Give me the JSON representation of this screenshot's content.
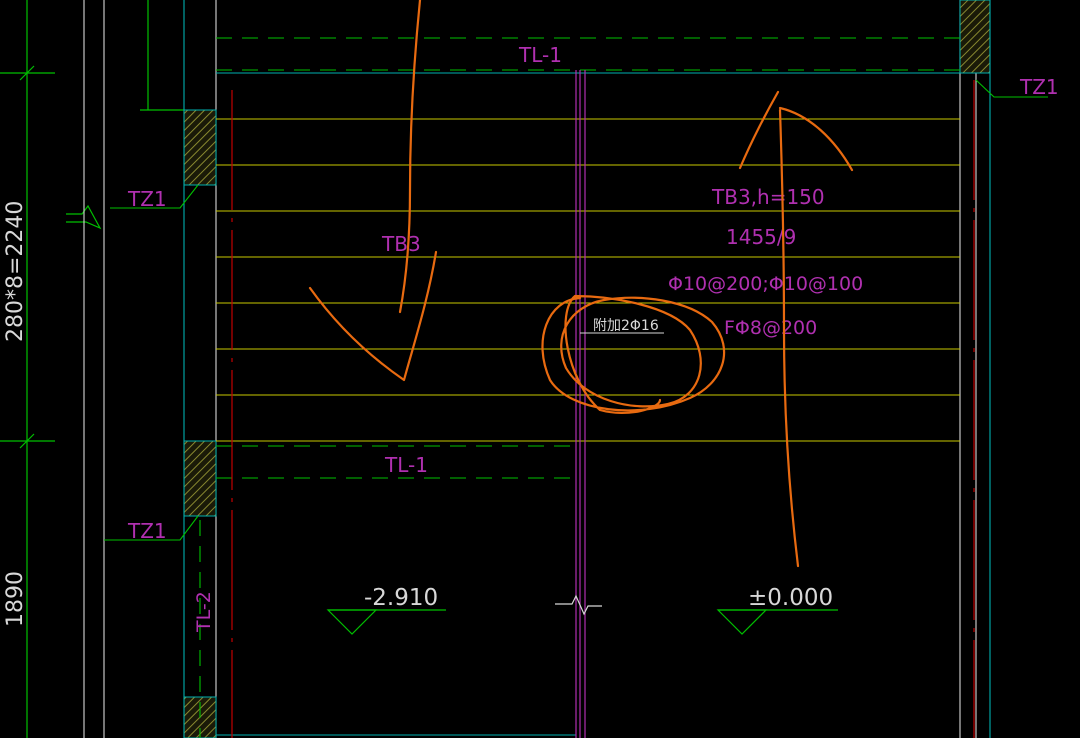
{
  "colors": {
    "background": "#000000",
    "green": "#00c000",
    "grid_white": "#d8d8d8",
    "cyan": "#00b0b0",
    "yellow": "#c8c800",
    "red": "#c00000",
    "magenta": "#b030b0",
    "annotation_orange": "#e86a10",
    "hatch": "#7a7a30"
  },
  "dimensions": {
    "stair_run": "280*8=2240",
    "lower": "1890"
  },
  "labels": {
    "tl1_top": "TL-1",
    "tl1_mid": "TL-1",
    "tl2": "TL-2",
    "tz1_right": "TZ1",
    "tz1_left_upper": "TZ1",
    "tz1_left_lower": "TZ1",
    "tb_left": "TB3",
    "tb_right": "TB3,h=150",
    "tb_size": "1455/9",
    "rebar_main": "Φ10@200;Φ10@100",
    "rebar_dist": "FΦ8@200",
    "added_bar": "附加2Φ16"
  },
  "elevations": {
    "left": "-2.910",
    "right": "±0.000"
  },
  "annotations": {
    "arrows": [
      "down-arrow",
      "up-arrow"
    ],
    "circle": "circled added bar"
  }
}
